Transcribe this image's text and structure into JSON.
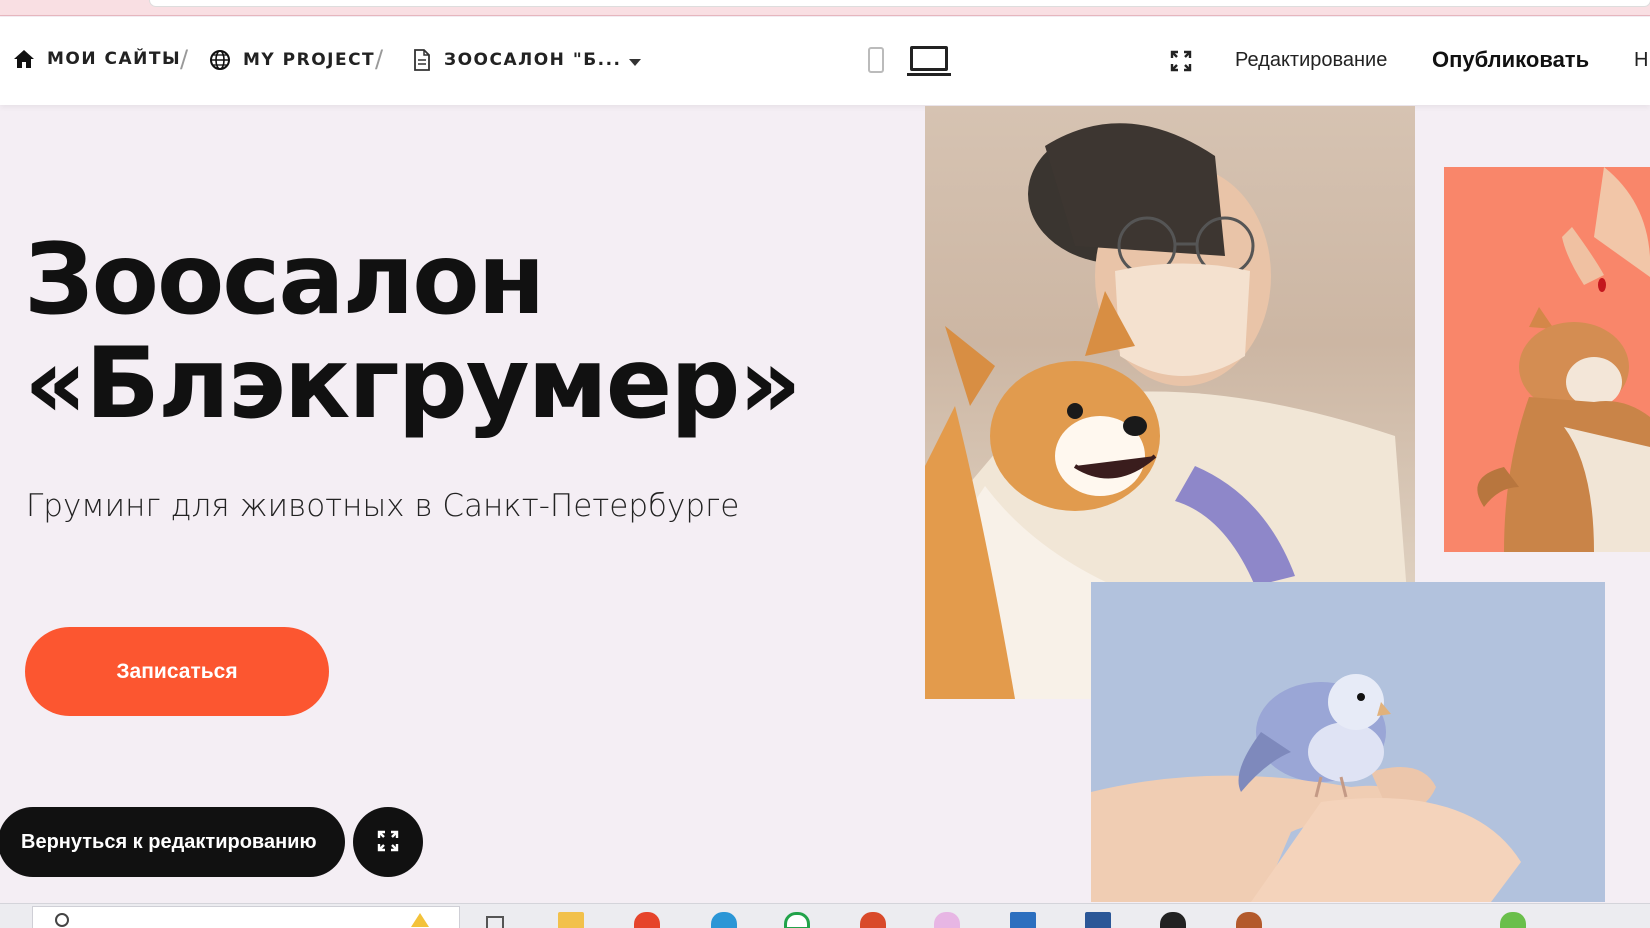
{
  "breadcrumbs": {
    "home": "МОИ САЙТЫ",
    "project": "MY PROJECT",
    "page": "ЗООСАЛОН \"Б..."
  },
  "toolbar": {
    "edit_mode": "Редактирование",
    "publish": "Опубликовать",
    "more": "Н"
  },
  "hero": {
    "title_line1": "Зоосалон",
    "title_line2": "«Блэкгрумер»",
    "subtitle": "Груминг для животных в Санкт-Петербурге",
    "cta": "Записаться"
  },
  "floating": {
    "back_to_edit": "Вернуться к редактированию"
  },
  "colors": {
    "accent": "#fc5630",
    "background": "#f4eef4",
    "cat_bg": "#f9866a",
    "bird_bg": "#b2c2dd"
  },
  "icons": {
    "home": "home-icon",
    "project": "globe-icon",
    "page": "document-icon",
    "mobile": "mobile-device-icon",
    "desktop": "laptop-device-icon",
    "fullscreen": "fullscreen-icon"
  }
}
